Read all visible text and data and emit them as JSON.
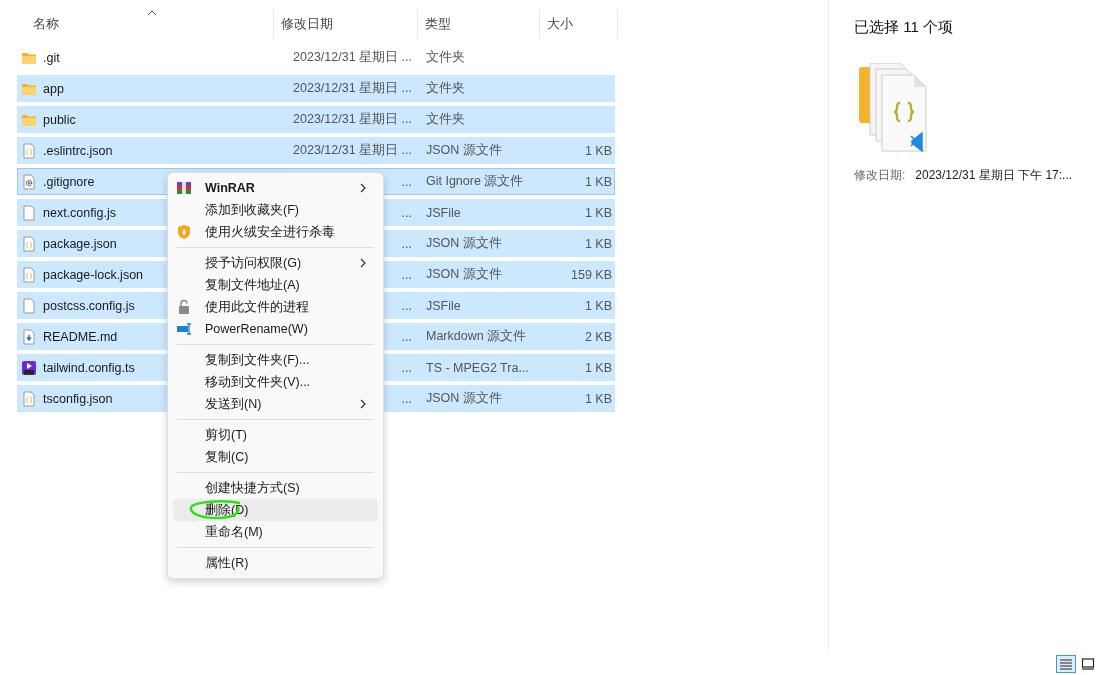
{
  "columns": [
    {
      "label": "名称",
      "sorted": true
    },
    {
      "label": "修改日期",
      "sorted": false
    },
    {
      "label": "类型",
      "sorted": false
    },
    {
      "label": "大小",
      "sorted": false
    }
  ],
  "files": [
    {
      "kind": "folder",
      "name": ".git",
      "date": "2023/12/31 星期日 ...",
      "type": "文件夹",
      "selected": false,
      "focused": false
    },
    {
      "kind": "folder",
      "name": "app",
      "date": "2023/12/31 星期日 ...",
      "type": "文件夹",
      "selected": true,
      "focused": false
    },
    {
      "kind": "folder",
      "name": "public",
      "date": "2023/12/31 星期日 ...",
      "type": "文件夹",
      "selected": true,
      "focused": false
    },
    {
      "kind": "json",
      "name": ".eslintrc.json",
      "date": "2023/12/31 星期日 ...",
      "type": "JSON 源文件",
      "size": "1 KB",
      "selected": true,
      "focused": false
    },
    {
      "kind": "gear",
      "name": ".gitignore",
      "date": "...",
      "type": "Git Ignore 源文件",
      "size": "1 KB",
      "selected": true,
      "focused": true
    },
    {
      "kind": "blank",
      "name": "next.config.js",
      "date": "...",
      "type": "JSFile",
      "size": "1 KB",
      "selected": true,
      "focused": false
    },
    {
      "kind": "json",
      "name": "package.json",
      "date": "...",
      "type": "JSON 源文件",
      "size": "1 KB",
      "selected": true,
      "focused": false
    },
    {
      "kind": "json",
      "name": "package-lock.json",
      "date": "...",
      "type": "JSON 源文件",
      "size": "159 KB",
      "selected": true,
      "focused": false
    },
    {
      "kind": "blank",
      "name": "postcss.config.js",
      "date": "...",
      "type": "JSFile",
      "size": "1 KB",
      "selected": true,
      "focused": false
    },
    {
      "kind": "markdown",
      "name": "README.md",
      "date": "...",
      "type": "Markdown 源文件",
      "size": "2 KB",
      "selected": true,
      "focused": false
    },
    {
      "kind": "ts",
      "name": "tailwind.config.ts",
      "date": "...",
      "type": "TS - MPEG2 Tra...",
      "size": "1 KB",
      "selected": true,
      "focused": false
    },
    {
      "kind": "json",
      "name": "tsconfig.json",
      "date": "...",
      "type": "JSON 源文件",
      "size": "1 KB",
      "selected": true,
      "focused": false
    }
  ],
  "context_menu": [
    {
      "kind": "item",
      "label": "WinRAR",
      "bold": true,
      "submenu": true,
      "hovered": false,
      "circled": false
    },
    {
      "kind": "item",
      "label": "添加到收藏夹(F)",
      "bold": false,
      "submenu": false,
      "hovered": false,
      "circled": false
    },
    {
      "kind": "item",
      "label": "使用火绒安全进行杀毒",
      "bold": false,
      "submenu": false,
      "hovered": false,
      "circled": false
    },
    {
      "kind": "separator"
    },
    {
      "kind": "item",
      "label": "授予访问权限(G)",
      "bold": false,
      "submenu": true,
      "hovered": false,
      "circled": false
    },
    {
      "kind": "item",
      "label": "复制文件地址(A)",
      "bold": false,
      "submenu": false,
      "hovered": false,
      "circled": false
    },
    {
      "kind": "item",
      "label": "使用此文件的进程",
      "bold": false,
      "submenu": false,
      "hovered": false,
      "circled": false
    },
    {
      "kind": "item",
      "label": "PowerRename(W)",
      "bold": false,
      "submenu": false,
      "hovered": false,
      "circled": false
    },
    {
      "kind": "separator"
    },
    {
      "kind": "item",
      "label": "复制到文件夹(F)...",
      "bold": false,
      "submenu": false,
      "hovered": false,
      "circled": false
    },
    {
      "kind": "item",
      "label": "移动到文件夹(V)...",
      "bold": false,
      "submenu": false,
      "hovered": false,
      "circled": false
    },
    {
      "kind": "item",
      "label": "发送到(N)",
      "bold": false,
      "submenu": true,
      "hovered": false,
      "circled": false
    },
    {
      "kind": "separator"
    },
    {
      "kind": "item",
      "label": "剪切(T)",
      "bold": false,
      "submenu": false,
      "hovered": false,
      "circled": false
    },
    {
      "kind": "item",
      "label": "复制(C)",
      "bold": false,
      "submenu": false,
      "hovered": false,
      "circled": false
    },
    {
      "kind": "separator"
    },
    {
      "kind": "item",
      "label": "创建快捷方式(S)",
      "bold": false,
      "submenu": false,
      "hovered": false,
      "circled": false
    },
    {
      "kind": "item",
      "label": "删除(D)",
      "bold": false,
      "submenu": false,
      "hovered": true,
      "circled": true
    },
    {
      "kind": "item",
      "label": "重命名(M)",
      "bold": false,
      "submenu": false,
      "hovered": false,
      "circled": false
    },
    {
      "kind": "separator"
    },
    {
      "kind": "item",
      "label": "属性(R)",
      "bold": false,
      "submenu": false,
      "hovered": false,
      "circled": false
    }
  ],
  "details_pane": {
    "title": "已选择 11 个项",
    "meta_label": "修改日期:",
    "meta_value": "2023/12/31 星期日 下午 17:..."
  },
  "view_buttons": [
    {
      "kind": "details",
      "selected": true
    },
    {
      "kind": "large-icons",
      "selected": false
    }
  ]
}
